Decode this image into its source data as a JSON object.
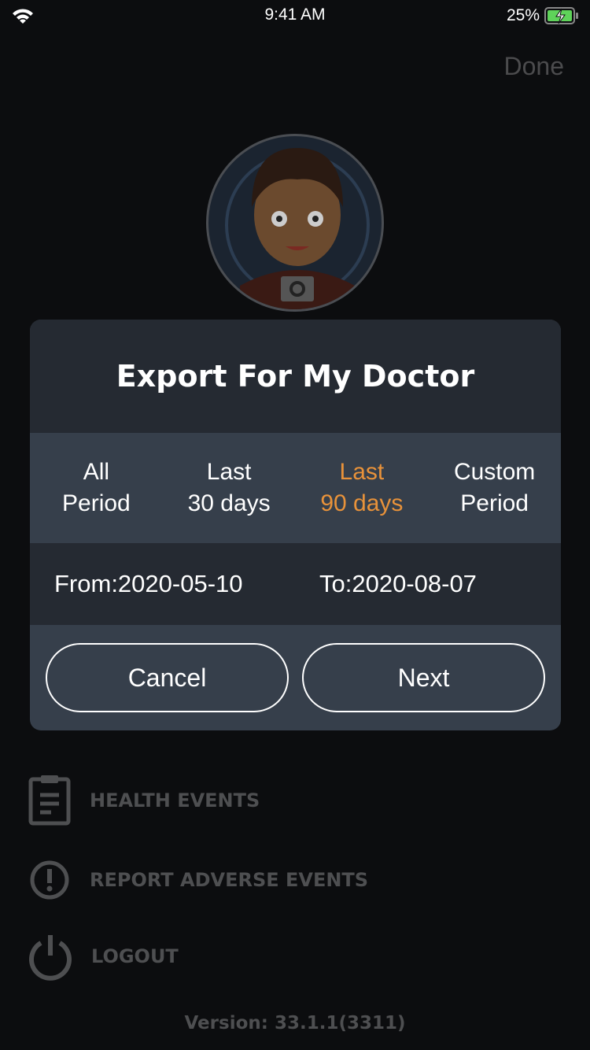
{
  "status_bar": {
    "time": "9:41 AM",
    "battery": "25%",
    "battery_color": "#5fd35a"
  },
  "nav": {
    "done_label": "Done"
  },
  "menu": [
    {
      "label": "HEALTH EVENTS",
      "icon": "clipboard-icon"
    },
    {
      "label": "REPORT ADVERSE EVENTS",
      "icon": "exclamation-icon"
    },
    {
      "label": "LOGOUT",
      "icon": "power-icon"
    }
  ],
  "version": "Version: 33.1.1(3311)",
  "modal": {
    "title": "Export For My Doctor",
    "tabs": [
      {
        "line1": "All",
        "line2": "Period",
        "active": false
      },
      {
        "line1": "Last",
        "line2": "30 days",
        "active": false
      },
      {
        "line1": "Last",
        "line2": "90 days",
        "active": true
      },
      {
        "line1": "Custom",
        "line2": "Period",
        "active": false
      }
    ],
    "from": "From:2020-05-10",
    "to": "To:2020-08-07",
    "cancel_label": "Cancel",
    "next_label": "Next",
    "accent": "#e8923a"
  }
}
